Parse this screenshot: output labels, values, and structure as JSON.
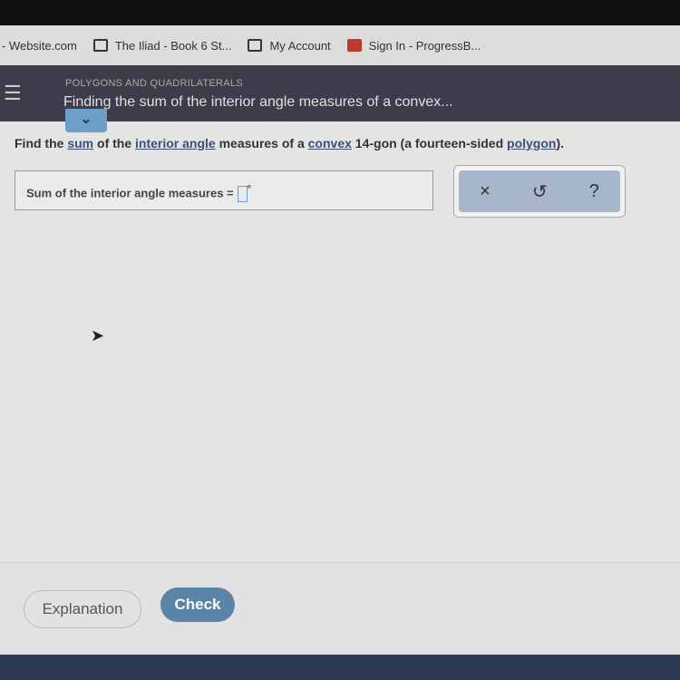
{
  "bookmarks": [
    "- Website.com",
    "The Iliad - Book 6 St...",
    "My Account",
    "Sign In - ProgressB..."
  ],
  "header": {
    "category": "POLYGONS AND QUADRILATERALS",
    "title": "Finding the sum of the interior angle measures of a convex..."
  },
  "question": {
    "p1": "Find the ",
    "sum": "sum",
    "p2": " of the ",
    "interior": "interior angle",
    "p3": " measures of a ",
    "convex": "convex",
    "p4": " 14-gon (a fourteen-sided ",
    "polygon": "polygon",
    "p5": ")."
  },
  "answer": {
    "label": "Sum of the interior angle measures =",
    "unit": "°",
    "value": ""
  },
  "tools": {
    "clear": "×",
    "undo": "↺",
    "help": "?"
  },
  "footer": {
    "explanation": "Explanation",
    "check": "Check"
  }
}
